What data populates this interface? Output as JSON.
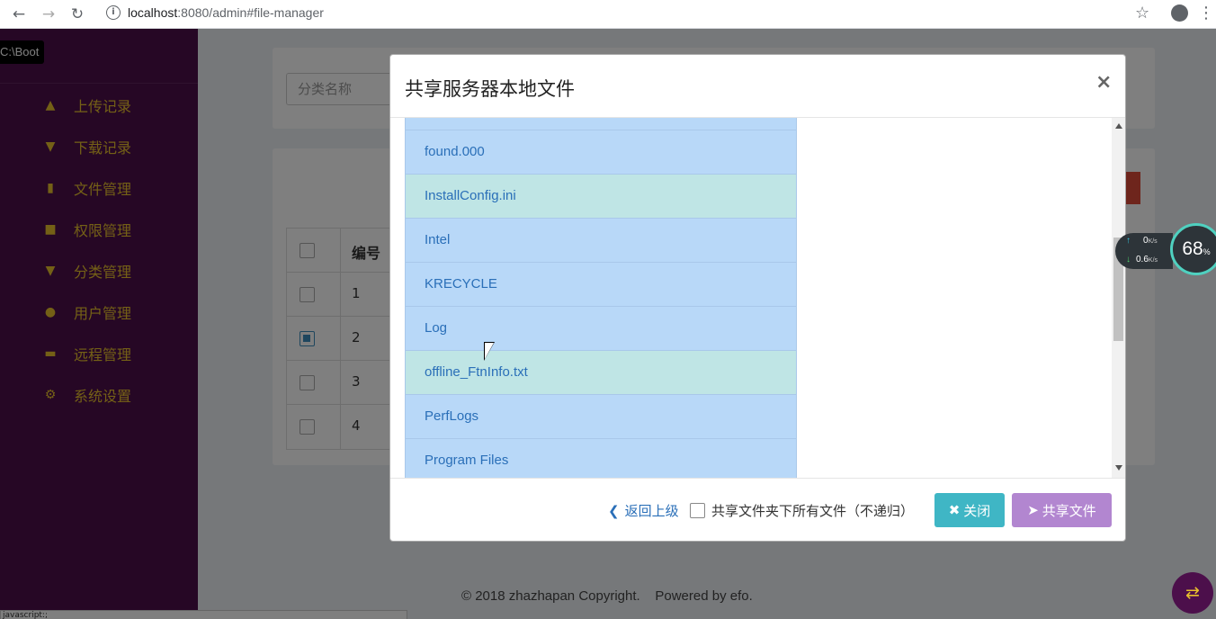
{
  "browser": {
    "url_host": "localhost",
    "url_rest": ":8080/admin#file-manager",
    "back_icon": "arrow-left-icon",
    "forward_icon": "arrow-right-icon",
    "reload_icon": "reload-icon",
    "info_icon": "info-icon",
    "star_icon": "star-icon",
    "account_icon": "account-icon",
    "menu_icon": "more-vert-icon"
  },
  "tooltip": "C:\\Boot",
  "sidebar": {
    "items": [
      {
        "label": "上传记录",
        "icon": "cloud-upload-icon"
      },
      {
        "label": "下载记录",
        "icon": "cloud-download-icon"
      },
      {
        "label": "文件管理",
        "icon": "file-icon"
      },
      {
        "label": "权限管理",
        "icon": "lock-icon"
      },
      {
        "label": "分类管理",
        "icon": "filter-icon"
      },
      {
        "label": "用户管理",
        "icon": "user-icon"
      },
      {
        "label": "远程管理",
        "icon": "folder-icon"
      },
      {
        "label": "系统设置",
        "icon": "gear-icon"
      }
    ],
    "text_color": "#e8c12d",
    "bg_color": "#4c0f4b"
  },
  "filter": {
    "placeholder": "分类名称"
  },
  "table": {
    "header": "编号",
    "rows": [
      {
        "id": "1",
        "checked": false
      },
      {
        "id": "2",
        "checked": true
      },
      {
        "id": "3",
        "checked": false
      },
      {
        "id": "4",
        "checked": false
      }
    ]
  },
  "footer": {
    "copyright": "© 2018 zhazhapan Copyright.    Powered by efo."
  },
  "status_bar": "javascript:;",
  "modal": {
    "title": "共享服务器本地文件",
    "close_glyph": "×",
    "files": [
      {
        "name": "found.000",
        "alt": false
      },
      {
        "name": "InstallConfig.ini",
        "alt": true
      },
      {
        "name": "Intel",
        "alt": false
      },
      {
        "name": "KRECYCLE",
        "alt": false
      },
      {
        "name": "Log",
        "alt": false
      },
      {
        "name": "offline_FtnInfo.txt",
        "alt": true
      },
      {
        "name": "PerfLogs",
        "alt": false
      },
      {
        "name": "Program Files",
        "alt": false
      }
    ],
    "back_label": "返回上级",
    "recursive_label": "共享文件夹下所有文件（不递归）",
    "close_button": "关闭",
    "share_button": "共享文件"
  },
  "net_widget": {
    "up": "0",
    "down": "0.6",
    "unit": "K/s",
    "gauge_value": "68",
    "gauge_unit": "%"
  }
}
